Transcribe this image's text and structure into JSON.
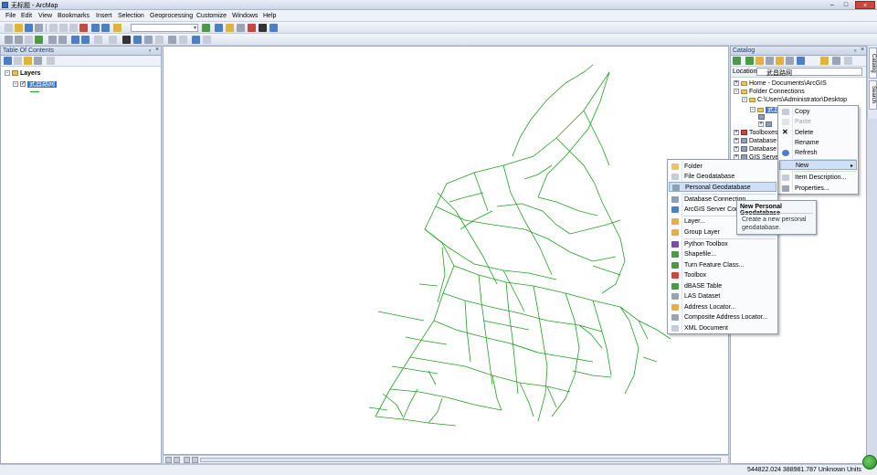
{
  "window": {
    "title": "无标题 - ArcMap"
  },
  "menubar": [
    "File",
    "Edit",
    "View",
    "Bookmarks",
    "Insert",
    "Selection",
    "Geoprocessing",
    "Customize",
    "Windows",
    "Help"
  ],
  "toc": {
    "title": "Table Of Contents",
    "pin": "ₓ",
    "close": "×",
    "root_label": "Layers",
    "layer_label": "武昌路网"
  },
  "catalog": {
    "title": "Catalog",
    "pin": "ₓ",
    "close": "×",
    "location_label": "Location:",
    "location_value": "武昌路网",
    "tree": [
      "Home - Documents\\ArcGIS",
      "Folder Connections",
      "C:\\Users\\Administrator\\Desktop",
      "Toolboxes",
      "Database",
      "Database",
      "GIS Server"
    ],
    "selected_item": "武昌路网"
  },
  "context_menu": {
    "items": [
      "Copy",
      "Paste",
      "Delete",
      "Rename",
      "Refresh",
      "New",
      "Item Description...",
      "Properties..."
    ]
  },
  "new_submenu": {
    "items": [
      "Folder",
      "File Geodatabase",
      "Personal Geodatabase",
      "Database Connection...",
      "ArcGIS Server Connection...",
      "Layer...",
      "Group Layer",
      "Python Toolbox",
      "Shapefile...",
      "Turn Feature Class...",
      "Toolbox",
      "dBASE Table",
      "LAS Dataset",
      "Address Locator...",
      "Composite Address Locator...",
      "XML Document"
    ],
    "highlighted": "Personal Geodatabase"
  },
  "tooltip": {
    "title": "New Personal Geodatabase",
    "body": "Create a new personal geodatabase."
  },
  "side_tabs": [
    "Catalog",
    "Search"
  ],
  "status": {
    "coordinates": "544822.024  388981.787 Unknown Units"
  },
  "colors": {
    "road_network": "#21a021",
    "highlight": "#3b74c6"
  }
}
